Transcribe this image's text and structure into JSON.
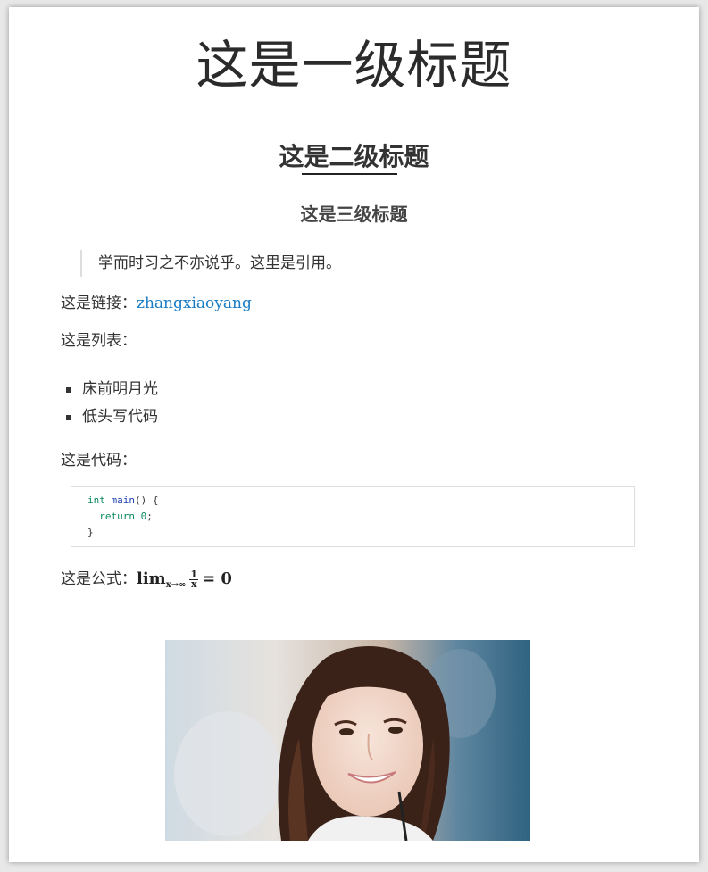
{
  "document": {
    "h1": "这是一级标题",
    "h2": "这是二级标题",
    "h3": "这是三级标题",
    "blockquote": "学而时习之不亦说乎。这里是引用。",
    "link_label": "这是链接：",
    "link_text": "zhangxiaoyang",
    "list_label": "这是列表：",
    "list_items": [
      "床前明月光",
      "低头写代码"
    ],
    "code_label": "这是代码：",
    "code": {
      "line1_type": "int",
      "line1_fn": "main",
      "line1_rest": "() {",
      "line2_kw": "return",
      "line2_num": "0",
      "line2_end": ";",
      "line3": "}"
    },
    "formula_label": "这是公式：",
    "formula": {
      "lim": "lim",
      "sub": "x→∞",
      "numerator": "1",
      "denominator": "x",
      "rest": "= 0"
    }
  },
  "colors": {
    "link": "#1a7dc4",
    "code_keyword": "#0b8a5e",
    "code_function": "#1a3fb0"
  }
}
